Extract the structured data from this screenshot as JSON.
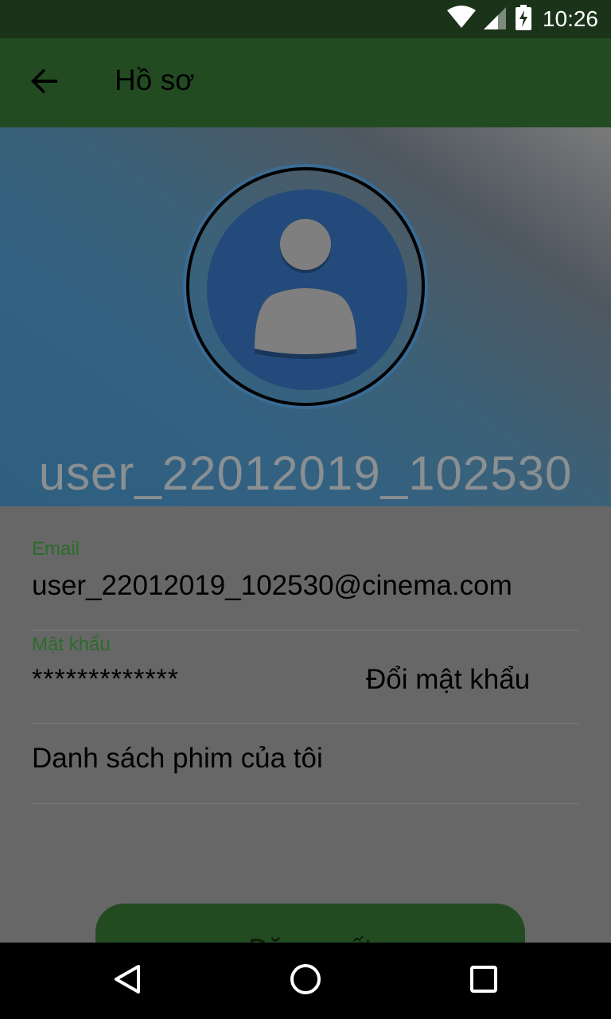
{
  "status_bar": {
    "time": "10:26",
    "icons": [
      "wifi-icon",
      "cellular-signal-icon",
      "battery-charging-icon"
    ]
  },
  "app_bar": {
    "title": "Hồ sơ",
    "back_icon": "arrow-left-icon"
  },
  "profile": {
    "username": "user_22012019_102530",
    "avatar_icon": "person-avatar-icon"
  },
  "fields": {
    "email_label": "Email",
    "email_value": "user_22012019_102530@cinema.com",
    "password_label": "Mật khẩu",
    "password_value": "*************",
    "change_password_label": "Đổi mật khẩu",
    "my_movies_label": "Danh sách phim của tôi"
  },
  "logout_button": {
    "label": "Đăng xuất"
  },
  "nav_bar": {
    "icons": [
      "triangle-back-icon",
      "circle-home-icon",
      "square-recents-icon"
    ]
  },
  "colors": {
    "status_bar": "#1b3318",
    "app_bar": "#224b22",
    "accent_label": "#2c6b2a",
    "content_bg": "#676767",
    "avatar_circle": "#234a7a"
  }
}
